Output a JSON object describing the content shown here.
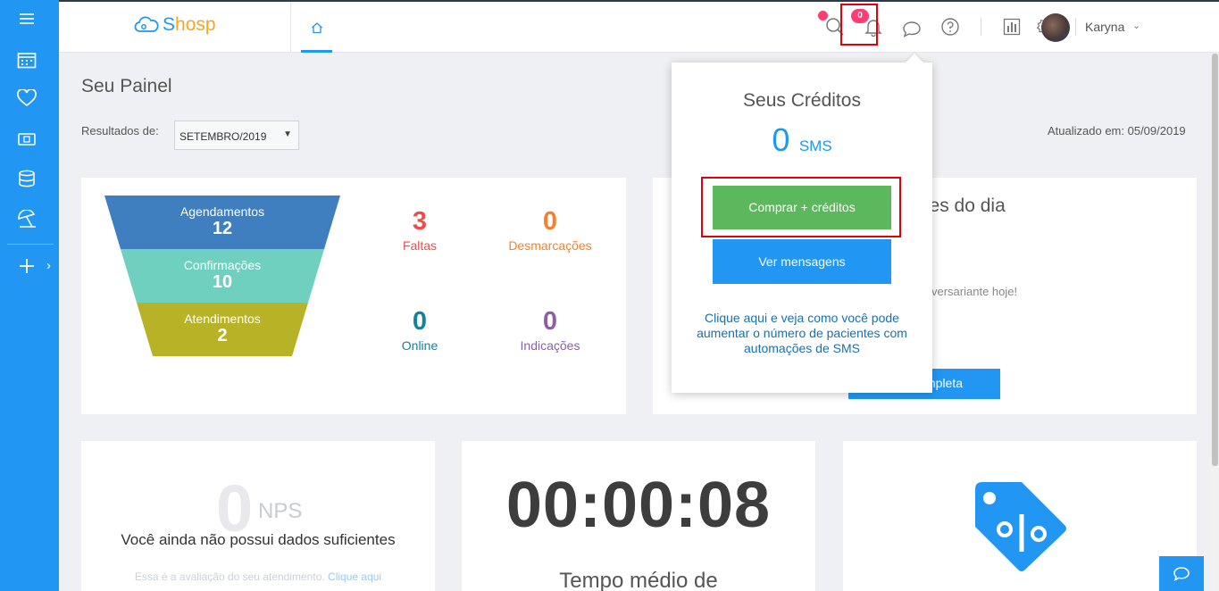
{
  "app": {
    "brand_name_first": "S",
    "brand_name_rest": "hosp",
    "accent_color": "#2196f3"
  },
  "sidebar": {
    "items": [
      {
        "icon": "menu-icon"
      },
      {
        "icon": "calendar-icon"
      },
      {
        "icon": "heart-icon"
      },
      {
        "icon": "money-icon"
      },
      {
        "icon": "database-icon"
      },
      {
        "icon": "beach-umbrella-icon"
      },
      {
        "icon": "plus-icon"
      }
    ],
    "expand_chevron": "›"
  },
  "topbar": {
    "home_tab_icon": "home-icon",
    "messages_badge": "0",
    "user_name": "Karyna",
    "user_chevron": "⌄"
  },
  "dashboard": {
    "title": "Seu Painel",
    "results_label": "Resultados de:",
    "month_value": "SETEMBRO/2019",
    "select_arrow": "▼",
    "updated_text": "Atualizado em: 05/09/2019",
    "funnel": [
      {
        "label": "Agendamentos",
        "value": "12",
        "color": "#3f7fbf"
      },
      {
        "label": "Confirmações",
        "value": "10",
        "color": "#6fd0bf"
      },
      {
        "label": "Atendimentos",
        "value": "2",
        "color": "#b8b227"
      }
    ],
    "stats": [
      {
        "value": "3",
        "label": "Faltas",
        "color": "#ef4b4b"
      },
      {
        "value": "0",
        "label": "Desmarcações",
        "color": "#f5822a"
      },
      {
        "value": "0",
        "label": "Online",
        "color": "#17809e"
      },
      {
        "value": "0",
        "label": "Indicações",
        "color": "#8e5fa8"
      }
    ],
    "birthday_title_partial": "ntes do dia",
    "birthday_message_partial": "versariante hoje!",
    "birthday_button_partial": "mpleta",
    "nps": {
      "value": "0",
      "label": "NPS",
      "message": "Você ainda não possui dados suficientes",
      "footer_text": "Essa é a avaliação do seu atendimento.",
      "footer_link": "Clique aqui"
    },
    "timer": {
      "value": "00:00:08",
      "caption": "Tempo médio de"
    }
  },
  "credits_popup": {
    "title": "Seus Créditos",
    "credits_value": "0",
    "credits_unit": "SMS",
    "buy_button": "Comprar + créditos",
    "messages_button": "Ver mensagens",
    "help_text": "Clique aqui e veja como você pode aumentar o número de pacientes com automações de SMS"
  }
}
